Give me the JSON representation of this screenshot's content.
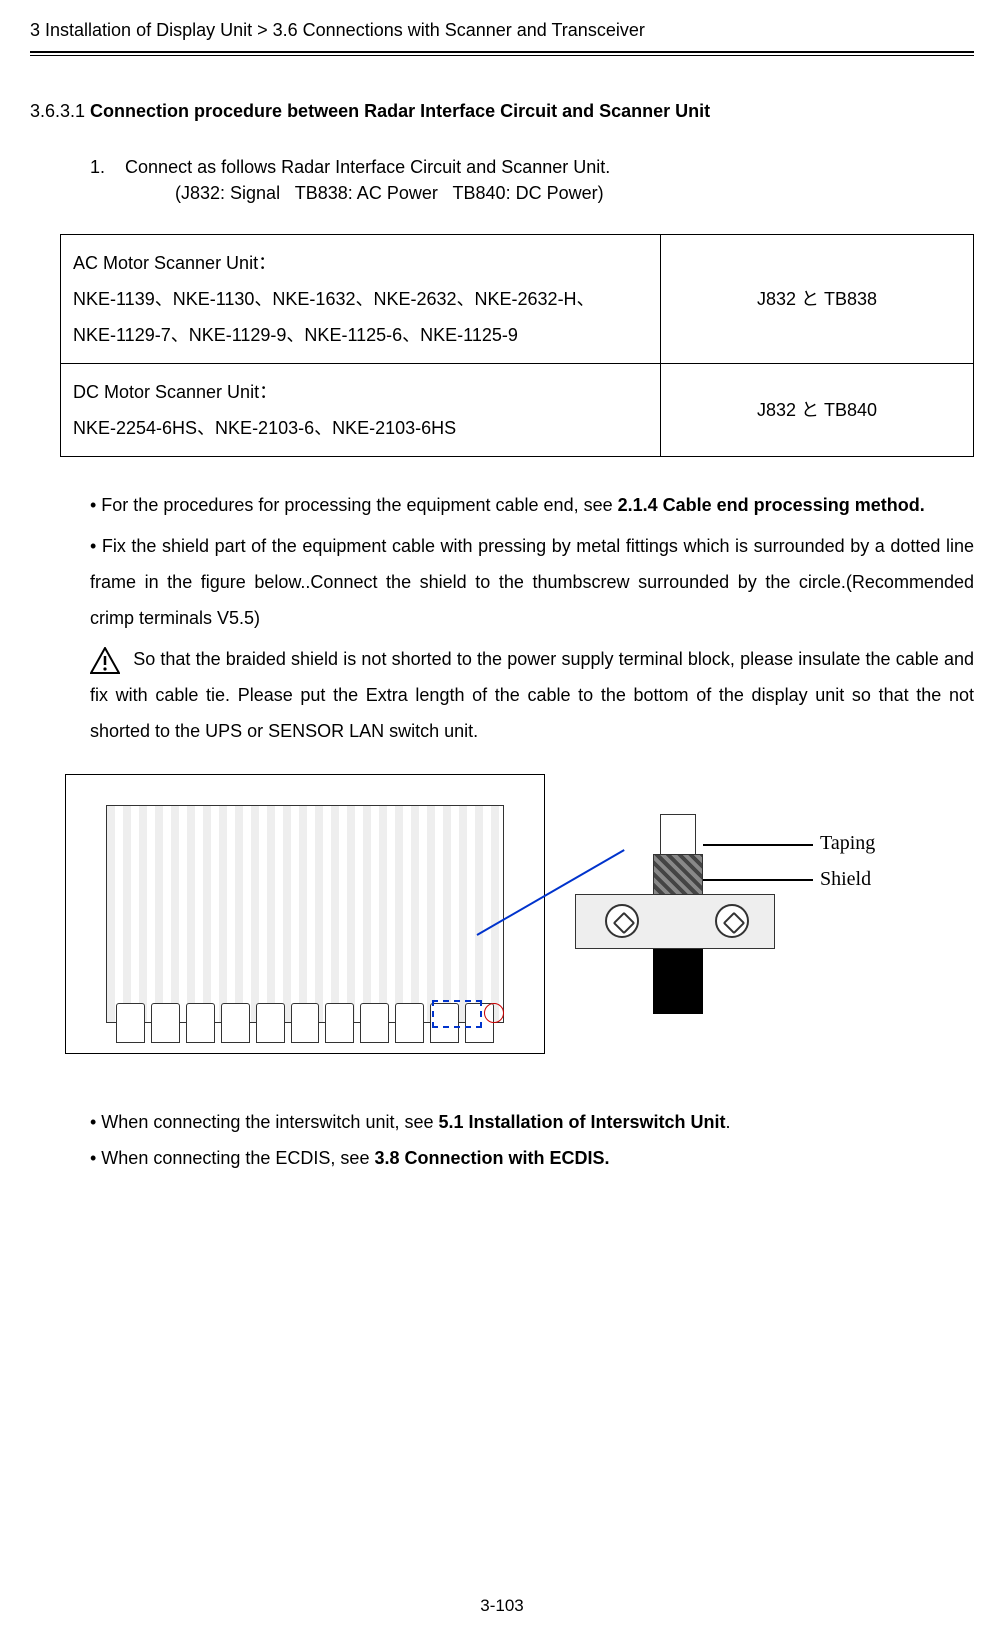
{
  "header": {
    "breadcrumb": "3 Installation of Display Unit > 3.6 Connections with Scanner and Transceiver"
  },
  "section": {
    "number": "3.6.3.1 ",
    "title": "Connection procedure between Radar Interface Circuit and Scanner Unit"
  },
  "step1": {
    "num": "1.",
    "text": "Connect as follows Radar Interface Circuit and Scanner Unit."
  },
  "connectors": {
    "a": "(J832: Signal",
    "b": "TB838: AC Power",
    "c": "TB840: DC Power)"
  },
  "table": {
    "row1": {
      "col1_line1": "AC Motor Scanner Unit：",
      "col1_line2": "NKE-1139、NKE-1130、NKE-1632、NKE-2632、NKE-2632-H、",
      "col1_line3": "NKE-1129-7、NKE-1129-9、NKE-1125-6、NKE-1125-9",
      "col2": "J832 と TB838"
    },
    "row2": {
      "col1_line1": "DC Motor Scanner Unit：",
      "col1_line2": "NKE-2254-6HS、NKE-2103-6、NKE-2103-6HS",
      "col2": "J832 と TB840"
    }
  },
  "para1": {
    "pre": "• For the procedures for processing the equipment cable end, see ",
    "bold": "2.1.4 Cable end processing method."
  },
  "para2": "• Fix the shield part of the equipment cable with pressing by metal fittings which is surrounded by a dotted line frame in the figure below..Connect the shield to the thumbscrew surrounded by the circle.(Recommended crimp terminals V5.5)",
  "para3": "So that the braided shield is not shorted to the power supply terminal block, please insulate the cable and fix with cable tie. Please put the Extra length of the cable to the bottom of the display unit so that the not shorted to the UPS or SENSOR LAN switch unit.",
  "figure": {
    "taping": "Taping",
    "shield": "Shield"
  },
  "bullets": {
    "b1_pre": "• When connecting the interswitch unit, see ",
    "b1_bold": "5.1 Installation of Interswitch Unit",
    "b1_post": ".",
    "b2_pre": "• When connecting the ECDIS, see ",
    "b2_bold": "3.8 Connection with ECDIS.",
    "b2_post": ""
  },
  "page": "3-103"
}
